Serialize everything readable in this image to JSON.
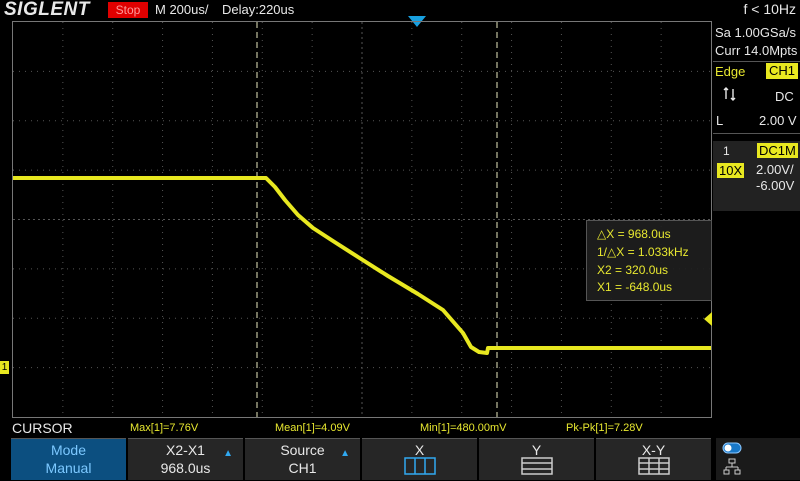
{
  "topbar": {
    "logo": "SIGLENT",
    "run_state": "Stop",
    "timebase": "M 200us/",
    "delay": "Delay:220us",
    "frequency": "f < 10Hz"
  },
  "acquisition": {
    "sample_rate": "Sa 1.00GSa/s",
    "memory": "Curr 14.0Mpts"
  },
  "trigger": {
    "type": "Edge",
    "source": "CH1",
    "slope_icon": "rise-fall-icon",
    "coupling": "DC",
    "level_label": "L",
    "level": "2.00 V"
  },
  "channel": {
    "number": "1",
    "coupling": "DC1M",
    "probe": "10X",
    "volts_per_div": "2.00V/",
    "offset": "-6.00V",
    "ground_marker": "1",
    "color": "#e8e820"
  },
  "cursor_readout": {
    "delta_x": "△X = 968.0us",
    "inv_delta_x": "1/△X = 1.033kHz",
    "x2": "X2 = 320.0us",
    "x1": "X1 = -648.0us"
  },
  "menu_title": "CURSOR",
  "measurements": {
    "max": "Max[1]=7.76V",
    "mean": "Mean[1]=4.09V",
    "min": "Min[1]=480.00mV",
    "pkpk": "Pk-Pk[1]=7.28V"
  },
  "softkeys": {
    "mode": {
      "label": "Mode",
      "value": "Manual"
    },
    "select": {
      "label": "X2-X1",
      "value": "968.0us"
    },
    "source": {
      "label": "Source",
      "value": "CH1"
    },
    "x": {
      "label": "X"
    },
    "y": {
      "label": "Y"
    },
    "xy": {
      "label": "X-Y"
    }
  },
  "colors": {
    "trace": "#e8e820",
    "accent": "#18a0e0",
    "stop": "#e00000"
  }
}
